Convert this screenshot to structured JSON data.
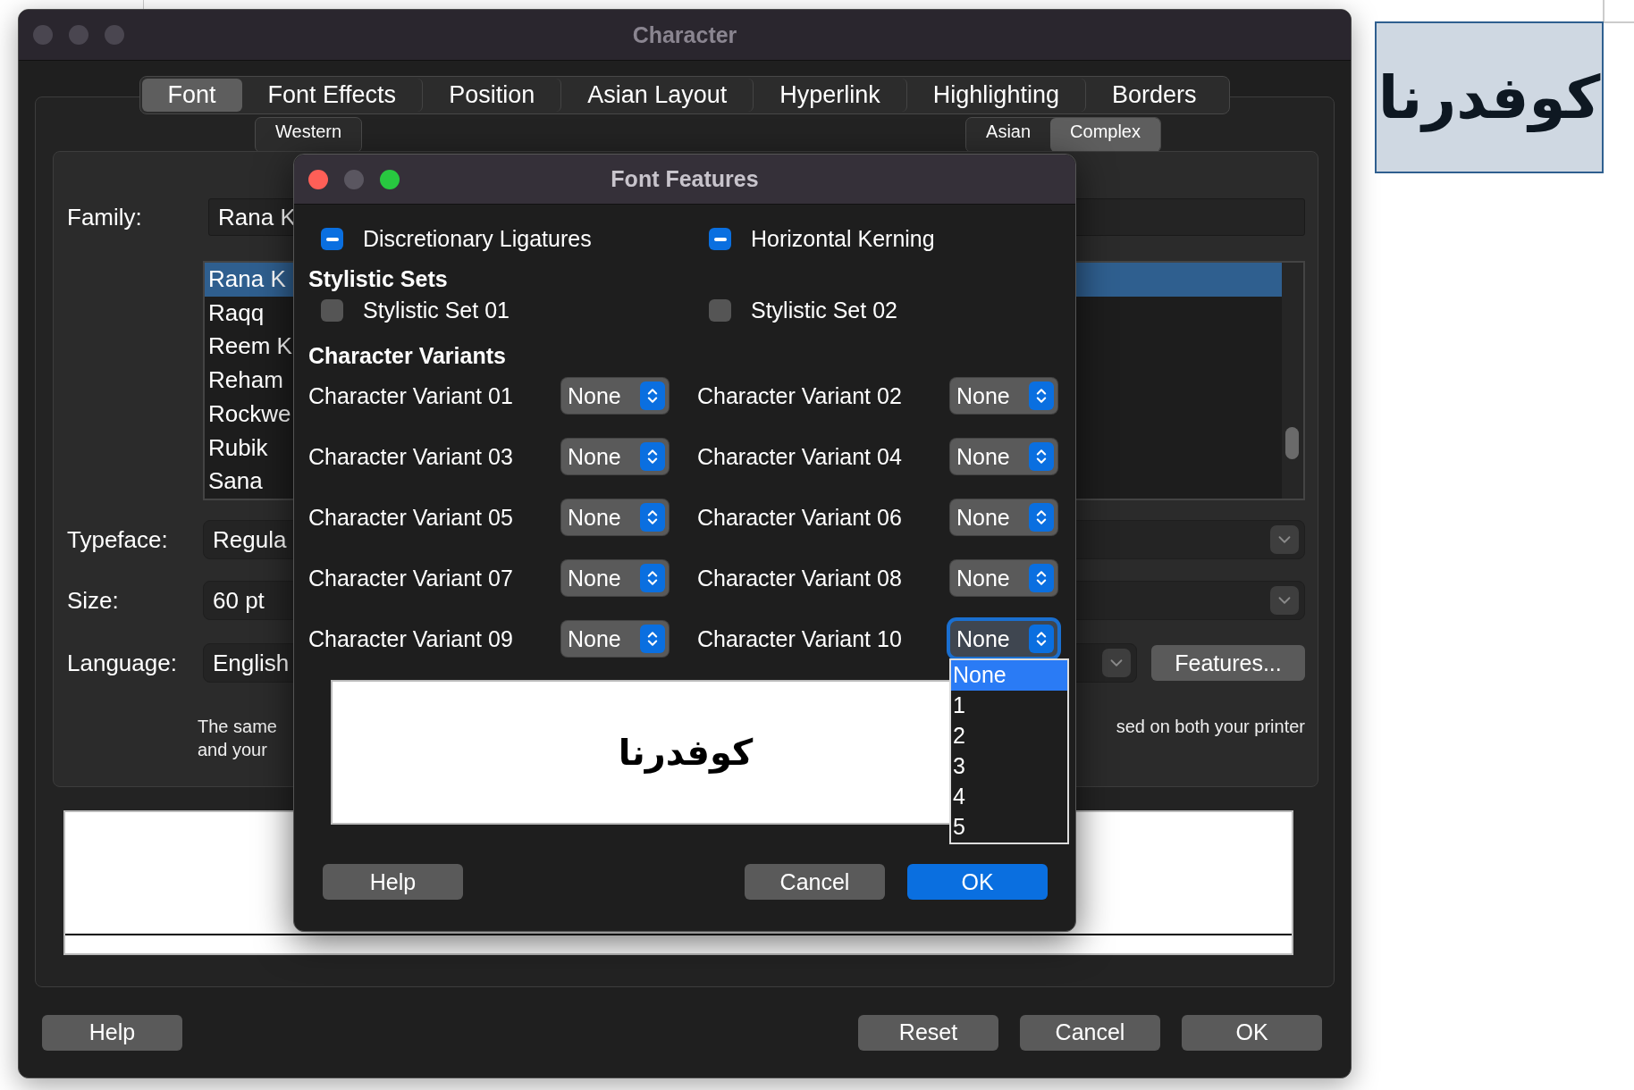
{
  "window": {
    "title": "Character"
  },
  "tabs": [
    {
      "label": "Font",
      "selected": true
    },
    {
      "label": "Font Effects",
      "selected": false
    },
    {
      "label": "Position",
      "selected": false
    },
    {
      "label": "Asian Layout",
      "selected": false
    },
    {
      "label": "Hyperlink",
      "selected": false
    },
    {
      "label": "Highlighting",
      "selected": false
    },
    {
      "label": "Borders",
      "selected": false
    }
  ],
  "script_tabs": [
    {
      "label": "Western",
      "selected": false
    },
    {
      "label": "Asian",
      "selected": false
    },
    {
      "label": "Complex",
      "selected": true
    }
  ],
  "font": {
    "family_label": "Family:",
    "family_value": "Rana K",
    "family_list": [
      {
        "name": "Rana K",
        "selected": true
      },
      {
        "name": "Raqq",
        "selected": false
      },
      {
        "name": "Reem K",
        "selected": false
      },
      {
        "name": "Reham",
        "selected": false
      },
      {
        "name": "Rockwe",
        "selected": false
      },
      {
        "name": "Rubik",
        "selected": false
      },
      {
        "name": "Sana",
        "selected": false
      }
    ],
    "typeface_label": "Typeface:",
    "typeface_value": "Regula",
    "size_label": "Size:",
    "size_value": "60 pt",
    "language_label": "Language:",
    "language_value": "English",
    "features_button": "Features...",
    "note_lines": [
      "The same",
      "and your"
    ],
    "note_tail": "sed on both your printer"
  },
  "buttons": {
    "help": "Help",
    "actions": [
      "Reset",
      "Cancel",
      "OK"
    ]
  },
  "dialog": {
    "title": "Font Features",
    "checks": [
      {
        "label": "Discretionary Ligatures",
        "mixed": true
      },
      {
        "label": "Horizontal Kerning",
        "mixed": true
      }
    ],
    "stylistic_heading": "Stylistic Sets",
    "stylistic_sets": [
      {
        "label": "Stylistic Set 01",
        "checked": false
      },
      {
        "label": "Stylistic Set 02",
        "checked": false
      }
    ],
    "variants_heading": "Character Variants",
    "variants": [
      {
        "label": "Character Variant 01",
        "value": "None",
        "focused": false
      },
      {
        "label": "Character Variant 02",
        "value": "None",
        "focused": false
      },
      {
        "label": "Character Variant 03",
        "value": "None",
        "focused": false
      },
      {
        "label": "Character Variant 04",
        "value": "None",
        "focused": false
      },
      {
        "label": "Character Variant 05",
        "value": "None",
        "focused": false
      },
      {
        "label": "Character Variant 06",
        "value": "None",
        "focused": false
      },
      {
        "label": "Character Variant 07",
        "value": "None",
        "focused": false
      },
      {
        "label": "Character Variant 08",
        "value": "None",
        "focused": false
      },
      {
        "label": "Character Variant 09",
        "value": "None",
        "focused": false
      },
      {
        "label": "Character Variant 10",
        "value": "None",
        "focused": true
      }
    ],
    "open_options": [
      {
        "label": "None",
        "selected": true
      },
      {
        "label": "1",
        "selected": false
      },
      {
        "label": "2",
        "selected": false
      },
      {
        "label": "3",
        "selected": false
      },
      {
        "label": "4",
        "selected": false
      },
      {
        "label": "5",
        "selected": false
      }
    ],
    "preview_text": "كوفدرنا",
    "buttons": {
      "help": "Help",
      "cancel": "Cancel",
      "ok": "OK"
    }
  },
  "side_word": {
    "text": "كوفدرنا"
  }
}
